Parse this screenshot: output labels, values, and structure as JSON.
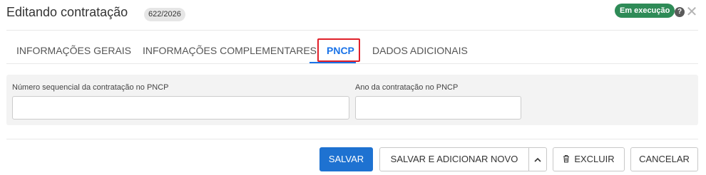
{
  "header": {
    "title": "Editando contratação",
    "count_badge": "622/2026",
    "status": "Em execução",
    "help": "?",
    "close": "✕"
  },
  "tabs": [
    {
      "label": "INFORMAÇÕES GERAIS",
      "active": false
    },
    {
      "label": "INFORMAÇÕES COMPLEMENTARES",
      "active": false
    },
    {
      "label": "PNCP",
      "active": true
    },
    {
      "label": "DADOS ADICIONAIS",
      "active": false
    }
  ],
  "form": {
    "sequence_label": "Número sequencial da contratação no PNCP",
    "sequence_value": "",
    "year_label": "Ano da contratação no PNCP",
    "year_value": ""
  },
  "footer": {
    "save": "SALVAR",
    "save_add_new": "SALVAR E ADICIONAR NOVO",
    "delete": "EXCLUIR",
    "cancel": "CANCELAR"
  },
  "colors": {
    "primary": "#1e72d1",
    "status": "#2e8b57",
    "highlight": "#e0202a"
  },
  "icons": [
    "help-icon",
    "close-icon",
    "chevron-up-icon",
    "trash-icon"
  ]
}
